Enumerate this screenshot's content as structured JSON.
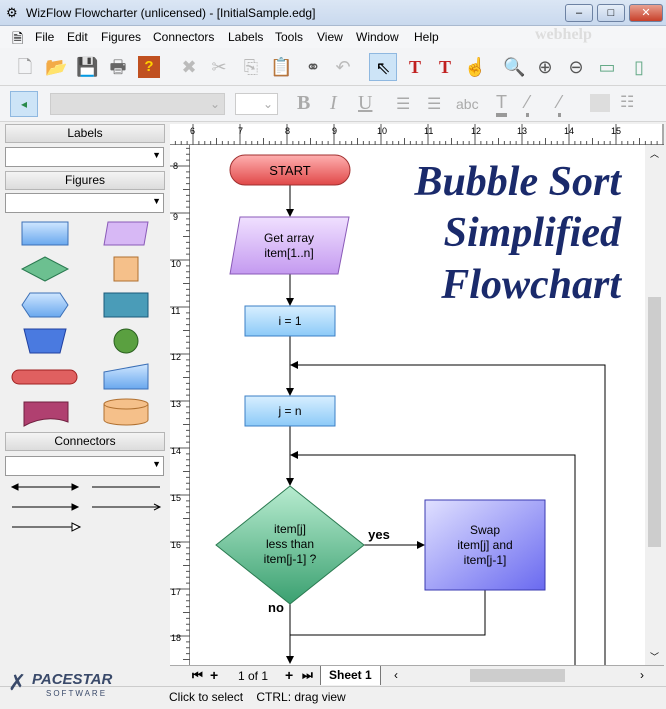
{
  "window": {
    "title": "WizFlow Flowcharter (unlicensed) - [InitialSample.edg]",
    "minimize": "–",
    "maximize": "□",
    "close": "✕"
  },
  "menu": [
    "File",
    "Edit",
    "Figures",
    "Connectors",
    "Labels",
    "Tools",
    "View",
    "Window",
    "Help"
  ],
  "toolbar": [
    "new-file",
    "open",
    "save",
    "print",
    "help",
    "delete",
    "cut",
    "copy",
    "paste",
    "find",
    "undo",
    "select",
    "text-tool",
    "label-tool",
    "connect-tool",
    "zoom",
    "zoom-in",
    "zoom-out",
    "zoom-page",
    "zoom-width"
  ],
  "format_bar": {
    "bold": "B",
    "italic": "I",
    "underline": "U",
    "spell": "abc"
  },
  "panels": {
    "labels": "Labels",
    "figures": "Figures",
    "connectors": "Connectors"
  },
  "ruler_top": [
    "6",
    "7",
    "8",
    "9",
    "10",
    "11",
    "12",
    "13",
    "14",
    "15"
  ],
  "ruler_left": [
    "8",
    "9",
    "10",
    "11",
    "12",
    "13",
    "14",
    "15",
    "16",
    "17",
    "18"
  ],
  "flowchart": {
    "title": [
      "Bubble Sort",
      "Simplified",
      "Flowchart"
    ],
    "start": "START",
    "get_array": [
      "Get array",
      "item[1..n]"
    ],
    "init_i": "i = 1",
    "init_j": "j = n",
    "decision": [
      "item[j]",
      "less than",
      "item[j-1] ?"
    ],
    "swap": [
      "Swap",
      "item[j] and",
      "item[j-1]"
    ],
    "yes": "yes",
    "no": "no"
  },
  "sheets": {
    "page": "1 of 1",
    "tab": "Sheet 1"
  },
  "status": "Click to select    CTRL: drag view",
  "logo": {
    "name": "PACESTAR",
    "sub": "SOFTWARE"
  },
  "watermark": "webhelp"
}
